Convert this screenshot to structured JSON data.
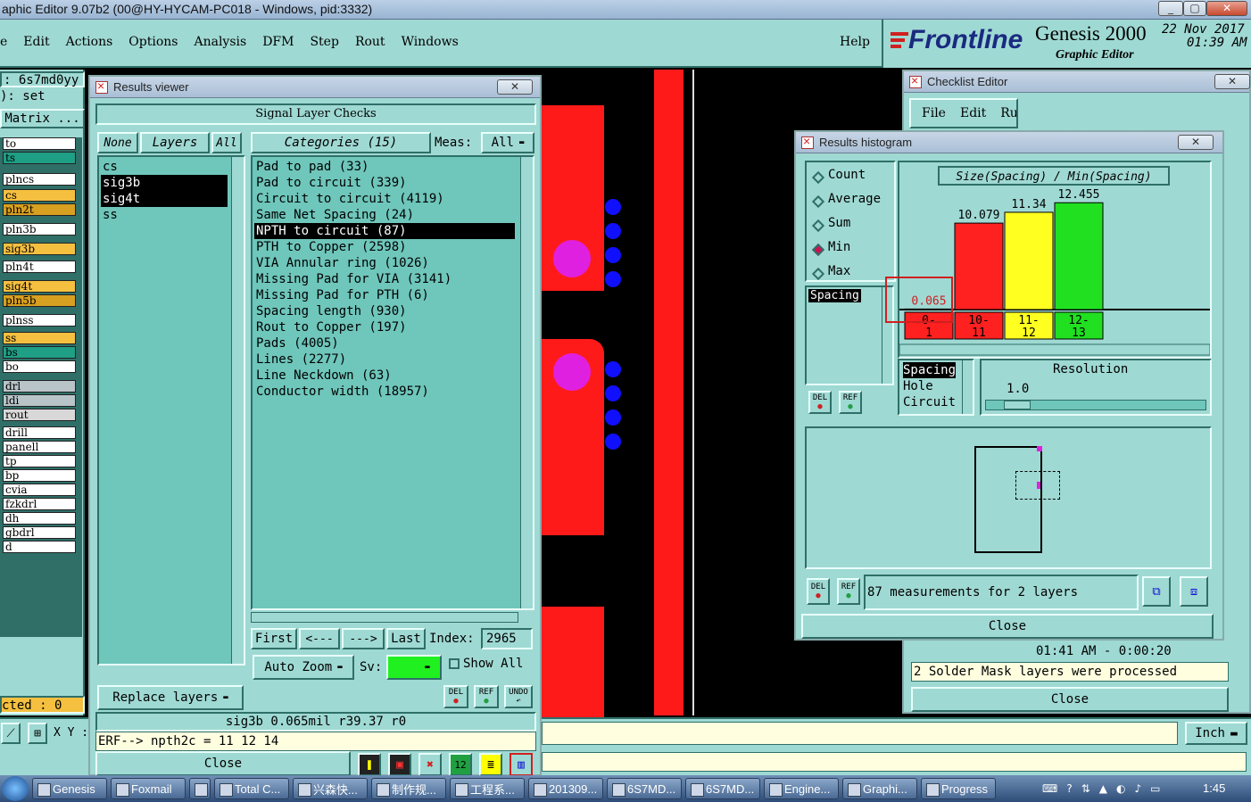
{
  "app": {
    "title": "aphic Editor 9.07b2 (00@HY-HYCAM-PC018 - Windows, pid:3332)",
    "menu": [
      "e",
      "Edit",
      "Actions",
      "Options",
      "Analysis",
      "DFM",
      "Step",
      "Rout",
      "Windows"
    ],
    "help": "Help",
    "brand": "Frontline",
    "product": "Genesis 2000",
    "subtitle": "Graphic Editor",
    "date": "22 Nov 2017",
    "time": "01:39 AM",
    "job_label": ": 6s7md0yy",
    "set_label": "): set",
    "matrix_label": "Matrix ...",
    "selected_label": "cted : 0",
    "xy_label": "X Y :",
    "units": "Inch"
  },
  "layers": [
    {
      "name": "to",
      "color": "#ffffff"
    },
    {
      "name": "ts",
      "color": "#1f9f86"
    },
    {
      "name": "plncs",
      "color": "#ffffff"
    },
    {
      "name": "cs",
      "color": "#f5c040"
    },
    {
      "name": "pln2t",
      "color": "#d8a020"
    },
    {
      "name": "pln3b",
      "color": "#ffffff"
    },
    {
      "name": "sig3b",
      "color": "#f5c040"
    },
    {
      "name": "pln4t",
      "color": "#ffffff"
    },
    {
      "name": "sig4t",
      "color": "#f5c040"
    },
    {
      "name": "pln5b",
      "color": "#d8a020"
    },
    {
      "name": "plnss",
      "color": "#ffffff"
    },
    {
      "name": "ss",
      "color": "#f5c040"
    },
    {
      "name": "bs",
      "color": "#1f9f86"
    },
    {
      "name": "bo",
      "color": "#ffffff"
    },
    {
      "name": "drl",
      "color": "#b8c4c8"
    },
    {
      "name": "ldi",
      "color": "#b8c4c8"
    },
    {
      "name": "rout",
      "color": "#d8d8d8"
    },
    {
      "name": "drill",
      "color": "#ffffff"
    },
    {
      "name": "panell",
      "color": "#ffffff"
    },
    {
      "name": "tp",
      "color": "#ffffff"
    },
    {
      "name": "bp",
      "color": "#ffffff"
    },
    {
      "name": "cvia",
      "color": "#ffffff"
    },
    {
      "name": "fzkdrl",
      "color": "#ffffff"
    },
    {
      "name": "dh",
      "color": "#ffffff"
    },
    {
      "name": "gbdrl",
      "color": "#ffffff"
    },
    {
      "name": "d",
      "color": "#ffffff"
    }
  ],
  "results_viewer": {
    "title": "Results viewer",
    "heading": "Signal Layer Checks",
    "none_btn": "None",
    "layers_btn": "Layers",
    "all_btn": "All",
    "categories_btn": "Categories (15)",
    "meas_label": "Meas:",
    "meas_value": "All",
    "layer_list": [
      "cs",
      "sig3b",
      "sig4t",
      "ss"
    ],
    "categories": [
      "Pad to pad (33)",
      "Pad to circuit (339)",
      "Circuit to circuit (4119)",
      "Same Net Spacing (24)",
      "NPTH to circuit (87)",
      "PTH to Copper (2598)",
      "VIA Annular ring (1026)",
      "Missing Pad for VIA (3141)",
      "Missing Pad for PTH (6)",
      "Spacing length (930)",
      "Rout to Copper (197)",
      "Pads (4005)",
      "Lines (2277)",
      "Line Neckdown (63)",
      "Conductor width (18957)"
    ],
    "first": "First",
    "prev": "<---",
    "next": "--->",
    "last": "Last",
    "index_label": "Index:",
    "index_value": "2965",
    "auto_zoom": "Auto Zoom",
    "sv_label": "Sv:",
    "show_all": "Show All",
    "replace_layers": "Replace layers",
    "del": "DEL",
    "ref": "REF",
    "undo": "UNDO",
    "status1": "sig3b 0.065mil   r39.37   r0",
    "status2": "ERF--> npth2c = 11 12 14",
    "close": "Close"
  },
  "checklist_editor": {
    "title": "Checklist Editor",
    "menu": [
      "File",
      "Edit",
      "Run"
    ],
    "time_row": "01:41  AM  - 0:00:20",
    "message": "2 Solder Mask layers were processed",
    "close": "Close"
  },
  "histogram": {
    "title": "Results histogram",
    "options": [
      "Count",
      "Average",
      "Sum",
      "Min",
      "Max"
    ],
    "selected_option": "Min",
    "measure_list": [
      "Spacing"
    ],
    "chart_title": "Size(Spacing) / Min(Spacing)",
    "type_list": [
      "Spacing",
      "Hole",
      "Circuit"
    ],
    "resolution_label": "Resolution",
    "resolution_value": "1.0",
    "summary": "87 measurements for 2 layers",
    "del": "DEL",
    "ref": "REF",
    "close": "Close"
  },
  "chart_data": {
    "type": "bar",
    "title": "Size(Spacing) / Min(Spacing)",
    "categories": [
      "0-1",
      "10-11",
      "11-12",
      "12-13"
    ],
    "values": [
      0.065,
      10.079,
      11.34,
      12.455
    ],
    "value_labels": [
      "0.065",
      "10.079",
      "11.34",
      "12.455"
    ],
    "colors": [
      "#ff2020",
      "#ff2020",
      "#ffff20",
      "#20e020"
    ],
    "ylim": [
      0,
      13
    ]
  },
  "taskbar": {
    "items": [
      "Genesis",
      "Foxmail",
      "",
      "Total C...",
      "兴森快...",
      "制作规...",
      "工程系...",
      "201309...",
      "6S7MD...",
      "6S7MD...",
      "Engine...",
      "Graphi...",
      "Progress"
    ],
    "clock": "1:45"
  }
}
